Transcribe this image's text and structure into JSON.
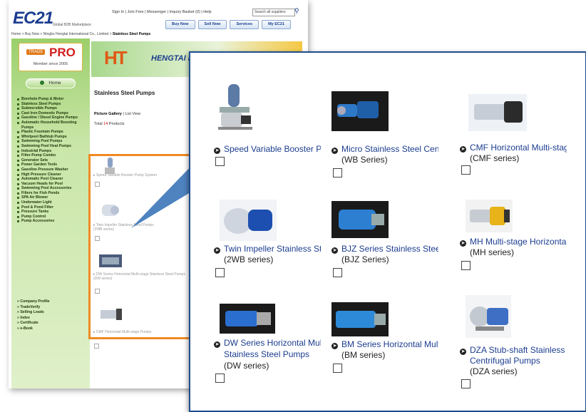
{
  "header": {
    "logo": "EC21",
    "logo_sub": "Global B2B Marketplace",
    "top_links": "Sign In | Join Free | Messenger | Inquiry Basket (0) | Help",
    "search_placeholder": "Search all suppliers",
    "nav": [
      "Buy Now",
      "Sell Now",
      "Services",
      "My EC21"
    ],
    "breadcrumb_prefix": "Home > Buy Now > Ningbo Hengtai International Co., Limited > ",
    "breadcrumb_current": "Stainless Steel Pumps"
  },
  "sidebar": {
    "badge_tag": "TRADE",
    "badge_pro": "PRO",
    "member_since": "Member since 2005",
    "home_label": "Home",
    "categories": [
      "Borehole Pump & Motor",
      "Stainless Steel Pumps",
      "Submersible Pumps",
      "Cast Iron Domestic Pumps",
      "Gasoline / Diesel Engine Pumps",
      "Automatic Household Boosting Pumps",
      "Plastic Fountain Pumps",
      "Whirlpool Bathtub Pumps",
      "Swimming Pool Pumps",
      "Swimming Pool Heat Pumps",
      "Industrial Pumps",
      "Filter-Pump Combo",
      "Generator Sets",
      "Power Garden Tools",
      "Gasoline Pressure Washer",
      "High Pressure Cleaner",
      "Automatic Pool Cleaner",
      "Vacuum Heads for Pool",
      "Swimming Pool Accessories",
      "Filters for Fish Ponds",
      "SPA Air Blower",
      "Underwater Light",
      "Pool & Pond Filter",
      "Pressure Tanks",
      "Pump Control",
      "Pump Accessories"
    ],
    "links": [
      "» Company Profile",
      "» TradeVerify",
      "» Selling Leads",
      "» Index",
      "» Certificate",
      "» e-Book"
    ]
  },
  "main": {
    "banner_logo": "HT",
    "banner_company": "HENGTAI INTERNATIONAL CO., LIMITED",
    "title": "Stainless Steel Pumps",
    "view_current": "Picture Gallery",
    "view_other": "List View",
    "total_prefix": "Total ",
    "total_count": "14",
    "total_suffix": " Products",
    "mini_items": [
      {
        "name": "Speed Variable Booster Pump System"
      },
      {
        "name": "Twin Impeller Stainless Steel Pumps",
        "series": "(2WB series)"
      },
      {
        "name": "DW Series Horizontal Multi-stage Stainless Steel Pumps",
        "series": "(DW series)"
      },
      {
        "name": "CMF Horizontal Multi-stage Pumps",
        "series": "(CMF series)"
      }
    ]
  },
  "zoom": {
    "products": [
      {
        "title": "Speed Variable Booster Pump System",
        "series": ""
      },
      {
        "title": "Micro Stainless Steel Centrifugal Pumps",
        "series": "(WB Series)"
      },
      {
        "title": "CMF Horizontal Multi-stage Pumps",
        "series": "(CMF series)"
      },
      {
        "title": "Twin Impeller Stainless Steel Pumps",
        "series": "(2WB series)"
      },
      {
        "title": "BJZ Series Stainless Steel Jet Pumps",
        "series": "(BJZ Series)"
      },
      {
        "title": "MH Multi-stage Horizontal Pumps",
        "series": "(MH series)"
      },
      {
        "title": "DW Series Horizontal Multi-stage",
        "title2": "Stainless Steel Pumps",
        "series": "(DW series)"
      },
      {
        "title": "BM Series Horizontal Multi-stage Pumps",
        "series": "(BM series)"
      },
      {
        "title": "DZA Stub-shaft Stainless Steel",
        "title2": "Centrifugal Pumps",
        "series": "(DZA series)"
      }
    ]
  },
  "colors": {
    "brand": "#1b3d8f",
    "highlight": "#f08a24",
    "callout": "#2f6db5"
  }
}
